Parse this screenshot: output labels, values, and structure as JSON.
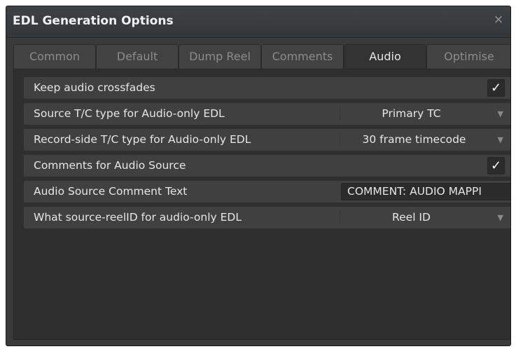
{
  "dialog": {
    "title": "EDL Generation Options",
    "close_icon": "×"
  },
  "tabs": [
    {
      "label": "Common",
      "active": false
    },
    {
      "label": "Default",
      "active": false
    },
    {
      "label": "Dump Reel",
      "active": false
    },
    {
      "label": "Comments",
      "active": false
    },
    {
      "label": "Audio",
      "active": true
    },
    {
      "label": "Optimise",
      "active": false
    }
  ],
  "rows": [
    {
      "label": "Keep audio crossfades",
      "control": "checkbox",
      "checked": true,
      "check_glyph": "✓"
    },
    {
      "label": "Source T/C type for Audio-only EDL",
      "control": "dropdown",
      "value": "Primary TC",
      "arrow": "▼"
    },
    {
      "label": "Record-side T/C type for Audio-only EDL",
      "control": "dropdown",
      "value": "30 frame timecode",
      "arrow": "▼"
    },
    {
      "label": "Comments for Audio Source",
      "control": "checkbox",
      "checked": true,
      "check_glyph": "✓"
    },
    {
      "label": "Audio Source Comment Text",
      "control": "text",
      "value": "COMMENT: AUDIO MAPPI"
    },
    {
      "label": "What source-reelID for audio-only EDL",
      "control": "dropdown",
      "value": "Reel ID",
      "arrow": "▼"
    }
  ],
  "colors": {
    "dialog_bg": "#3a3a3a",
    "panel_bg": "#2f2f2f",
    "row_bg": "#404040",
    "text": "#e6e6e6",
    "inactive_tab_text": "#8c8c8c"
  }
}
